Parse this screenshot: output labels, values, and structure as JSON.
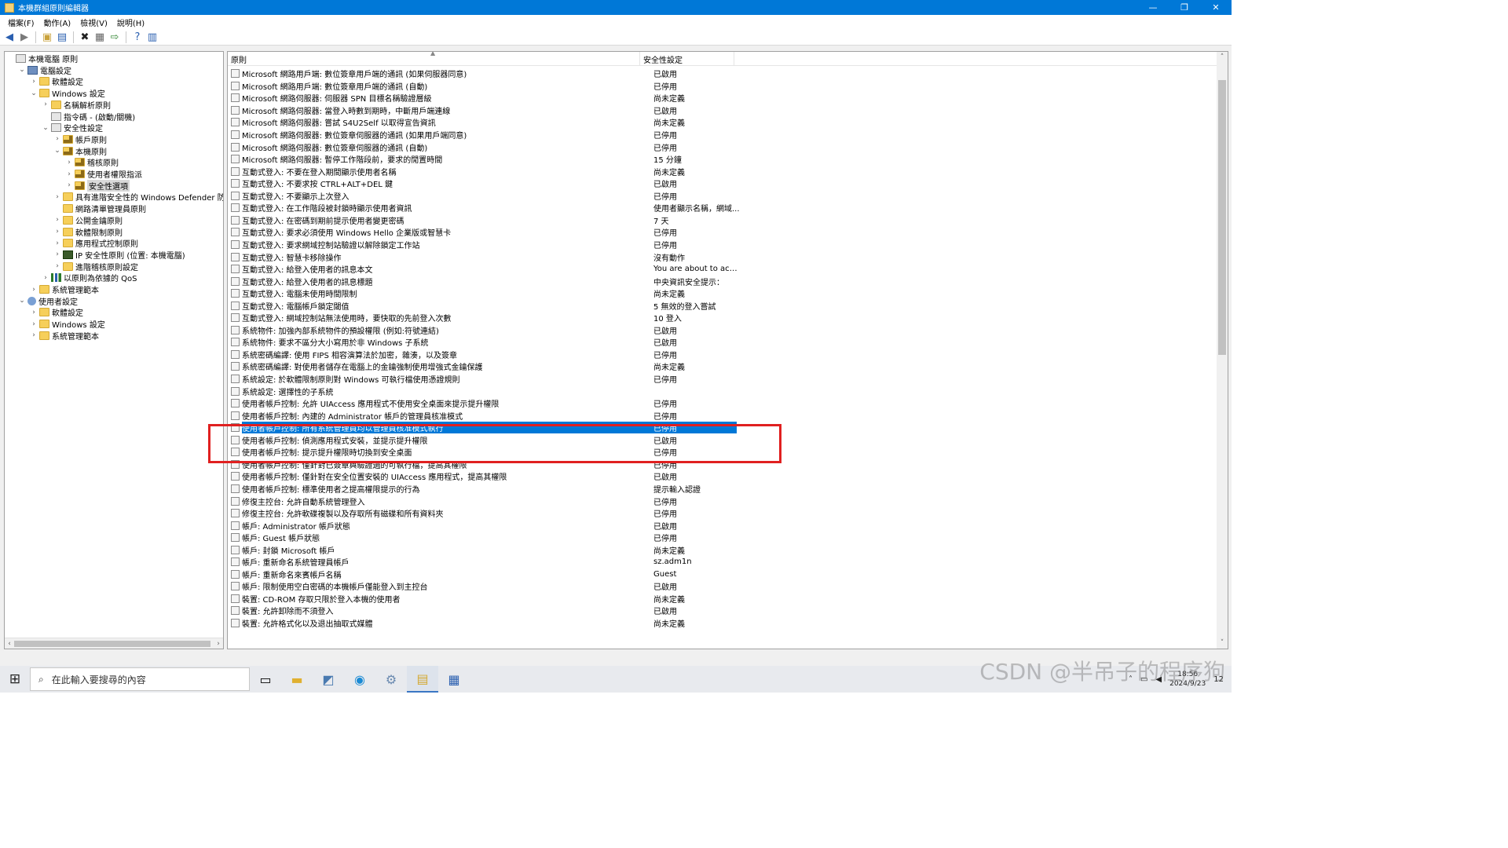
{
  "window": {
    "title": "本機群組原則編輯器",
    "minimize": "—",
    "maximize": "❐",
    "close": "✕"
  },
  "menu": [
    "檔案(F)",
    "動作(A)",
    "檢視(V)",
    "說明(H)"
  ],
  "tree": [
    {
      "label": "本機電腦 原則",
      "depth": 0,
      "chevron": "",
      "icon": "policy"
    },
    {
      "label": "電腦設定",
      "depth": 1,
      "chevron": "⌄",
      "icon": "computer"
    },
    {
      "label": "軟體設定",
      "depth": 2,
      "chevron": "›",
      "icon": "folder"
    },
    {
      "label": "Windows 設定",
      "depth": 2,
      "chevron": "⌄",
      "icon": "folder"
    },
    {
      "label": "名稱解析原則",
      "depth": 3,
      "chevron": "›",
      "icon": "folder"
    },
    {
      "label": "指令碼 - (啟動/關機)",
      "depth": 3,
      "chevron": "",
      "icon": "policy"
    },
    {
      "label": "安全性設定",
      "depth": 3,
      "chevron": "⌄",
      "icon": "policy"
    },
    {
      "label": "帳戶原則",
      "depth": 4,
      "chevron": "›",
      "icon": "folder lock"
    },
    {
      "label": "本機原則",
      "depth": 4,
      "chevron": "⌄",
      "icon": "folder lock"
    },
    {
      "label": "稽核原則",
      "depth": 5,
      "chevron": "›",
      "icon": "folder lock"
    },
    {
      "label": "使用者權限指派",
      "depth": 5,
      "chevron": "›",
      "icon": "folder lock"
    },
    {
      "label": "安全性選項",
      "depth": 5,
      "chevron": "›",
      "icon": "folder lock",
      "selected": true
    },
    {
      "label": "具有進階安全性的 Windows Defender 防火牆",
      "depth": 4,
      "chevron": "›",
      "icon": "folder"
    },
    {
      "label": "網路清單管理員原則",
      "depth": 4,
      "chevron": "",
      "icon": "folder"
    },
    {
      "label": "公開金鑰原則",
      "depth": 4,
      "chevron": "›",
      "icon": "folder"
    },
    {
      "label": "軟體限制原則",
      "depth": 4,
      "chevron": "›",
      "icon": "folder"
    },
    {
      "label": "應用程式控制原則",
      "depth": 4,
      "chevron": "›",
      "icon": "folder"
    },
    {
      "label": "IP 安全性原則 (位置: 本機電腦)",
      "depth": 4,
      "chevron": "›",
      "icon": "ipsec"
    },
    {
      "label": "進階稽核原則設定",
      "depth": 4,
      "chevron": "›",
      "icon": "folder"
    },
    {
      "label": "以原則為依據的 QoS",
      "depth": 3,
      "chevron": "›",
      "icon": "chart"
    },
    {
      "label": "系統管理範本",
      "depth": 2,
      "chevron": "›",
      "icon": "folder"
    },
    {
      "label": "使用者設定",
      "depth": 1,
      "chevron": "⌄",
      "icon": "user"
    },
    {
      "label": "軟體設定",
      "depth": 2,
      "chevron": "›",
      "icon": "folder"
    },
    {
      "label": "Windows 設定",
      "depth": 2,
      "chevron": "›",
      "icon": "folder"
    },
    {
      "label": "系統管理範本",
      "depth": 2,
      "chevron": "›",
      "icon": "folder"
    }
  ],
  "columns": {
    "policy": "原則",
    "setting": "安全性設定"
  },
  "rows": [
    {
      "name": "Microsoft 網路用戶端: 數位簽章用戶端的通訊 (如果伺服器同意)",
      "value": "已啟用"
    },
    {
      "name": "Microsoft 網路用戶端: 數位簽章用戶端的通訊 (自動)",
      "value": "已停用"
    },
    {
      "name": "Microsoft 網路伺服器: 伺服器 SPN 目標名稱驗證層級",
      "value": "尚未定義"
    },
    {
      "name": "Microsoft 網路伺服器: 當登入時數到期時，中斷用戶端連線",
      "value": "已啟用"
    },
    {
      "name": "Microsoft 網路伺服器: 嘗試 S4U2Self 以取得宣告資訊",
      "value": "尚未定義"
    },
    {
      "name": "Microsoft 網路伺服器: 數位簽章伺服器的通訊 (如果用戶端同意)",
      "value": "已停用"
    },
    {
      "name": "Microsoft 網路伺服器: 數位簽章伺服器的通訊 (自動)",
      "value": "已停用"
    },
    {
      "name": "Microsoft 網路伺服器: 暫停工作階段前，要求的閒置時間",
      "value": "15 分鐘"
    },
    {
      "name": "互動式登入: 不要在登入期間顯示使用者名稱",
      "value": "尚未定義"
    },
    {
      "name": "互動式登入: 不要求按 CTRL+ALT+DEL 鍵",
      "value": "已啟用"
    },
    {
      "name": "互動式登入: 不要顯示上次登入",
      "value": "已停用"
    },
    {
      "name": "互動式登入: 在工作階段被封鎖時顯示使用者資訊",
      "value": "使用者顯示名稱，網域..."
    },
    {
      "name": "互動式登入: 在密碼到期前提示使用者變更密碼",
      "value": "7 天"
    },
    {
      "name": "互動式登入: 要求必須使用 Windows Hello 企業版或智慧卡",
      "value": "已停用"
    },
    {
      "name": "互動式登入: 要求網域控制站驗證以解除鎖定工作站",
      "value": "已停用"
    },
    {
      "name": "互動式登入: 智慧卡移除操作",
      "value": "沒有動作"
    },
    {
      "name": "互動式登入: 給登入使用者的訊息本文",
      "value": "You are about to acces..."
    },
    {
      "name": "互動式登入: 給登入使用者的訊息標題",
      "value": "中央資訊安全提示："
    },
    {
      "name": "互動式登入: 電腦未使用時間限制",
      "value": "尚未定義"
    },
    {
      "name": "互動式登入: 電腦帳戶鎖定閾值",
      "value": "5 無效的登入嘗試"
    },
    {
      "name": "互動式登入: 網域控制站無法使用時，要快取的先前登入次數",
      "value": "10 登入"
    },
    {
      "name": "系統物件: 加強內部系統物件的預設權限 (例如:符號連結)",
      "value": "已啟用"
    },
    {
      "name": "系統物件: 要求不區分大小寫用於非 Windows 子系統",
      "value": "已啟用"
    },
    {
      "name": "系統密碼編譯: 使用 FIPS 相容演算法於加密，雜湊，以及簽章",
      "value": "已停用"
    },
    {
      "name": "系統密碼編譯: 對使用者儲存在電腦上的金鑰強制使用增強式金鑰保護",
      "value": "尚未定義"
    },
    {
      "name": "系統設定: 於軟體限制原則對 Windows 可執行檔使用憑證規則",
      "value": "已停用"
    },
    {
      "name": "系統設定: 選擇性的子系統",
      "value": ""
    },
    {
      "name": "使用者帳戶控制: 允許 UIAccess 應用程式不使用安全桌面來提示提升權限",
      "value": "已停用"
    },
    {
      "name": "使用者帳戶控制: 內建的 Administrator 帳戶的管理員核准模式",
      "value": "已停用"
    },
    {
      "name": "使用者帳戶控制: 所有系統管理員均以管理員核准模式執行",
      "value": "已停用",
      "selected": true
    },
    {
      "name": "使用者帳戶控制: 偵測應用程式安裝，並提示提升權限",
      "value": "已啟用"
    },
    {
      "name": "使用者帳戶控制: 提示提升權限時切換到安全桌面",
      "value": "已停用"
    },
    {
      "name": "使用者帳戶控制: 僅針對已簽章與驗證過的可執行檔，提高其權限",
      "value": "已停用"
    },
    {
      "name": "使用者帳戶控制: 僅針對在安全位置安裝的 UIAccess 應用程式，提高其權限",
      "value": "已啟用"
    },
    {
      "name": "使用者帳戶控制: 標準使用者之提高權限提示的行為",
      "value": "提示輸入認證"
    },
    {
      "name": "修復主控台: 允許自動系統管理登入",
      "value": "已停用"
    },
    {
      "name": "修復主控台: 允許軟碟複製以及存取所有磁碟和所有資料夾",
      "value": "已停用"
    },
    {
      "name": "帳戶: Administrator 帳戶狀態",
      "value": "已啟用"
    },
    {
      "name": "帳戶: Guest 帳戶狀態",
      "value": "已停用"
    },
    {
      "name": "帳戶: 封鎖 Microsoft 帳戶",
      "value": "尚未定義"
    },
    {
      "name": "帳戶: 重新命名系統管理員帳戶",
      "value": "sz.adm1n"
    },
    {
      "name": "帳戶: 重新命名來賓帳戶名稱",
      "value": "Guest"
    },
    {
      "name": "帳戶: 限制使用空白密碼的本機帳戶僅能登入到主控台",
      "value": "已啟用"
    },
    {
      "name": "裝置: CD-ROM 存取只限於登入本機的使用者",
      "value": "尚未定義"
    },
    {
      "name": "裝置: 允許卸除而不須登入",
      "value": "已啟用"
    },
    {
      "name": "裝置: 允許格式化以及退出抽取式媒體",
      "value": "尚未定義"
    }
  ],
  "taskbar": {
    "search_placeholder": "在此輸入要搜尋的內容",
    "time": "18:56",
    "date": "2024/9/23",
    "notifications": "12"
  },
  "watermark": "CSDN @半吊子的程序狗"
}
